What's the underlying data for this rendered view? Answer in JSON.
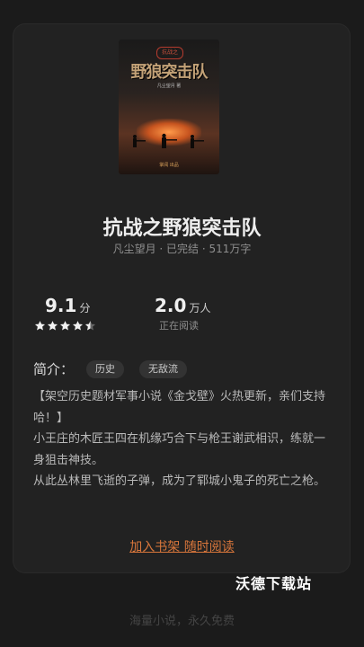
{
  "book": {
    "cover": {
      "series_tag": "抗战之",
      "title": "野狼突击队",
      "author_line": "凡尘望月 著",
      "publisher": "掌阅 出品"
    },
    "title": "抗战之野狼突击队",
    "meta": "凡尘望月 · 已完结 · 511万字"
  },
  "stats": {
    "score_value": "9.1",
    "score_unit": "分",
    "rating_stars": 4.5,
    "readers_value": "2.0",
    "readers_unit": "万人",
    "readers_label": "正在阅读"
  },
  "intro": {
    "label": "简介：",
    "tags": [
      "历史",
      "无敌流"
    ],
    "paragraphs": [
      "【架空历史题材军事小说《金戈壁》火热更新，亲们支持哈！】",
      "小王庄的木匠王四在机缘巧合下与枪王谢武相识，练就一身狙击神技。",
      "从此丛林里飞逝的子弹，成为了郓城小鬼子的死亡之枪。"
    ]
  },
  "cta_label": "加入书架 随时阅读",
  "watermark": "沃德下载站",
  "footer": "海量小说，永久免费",
  "colors": {
    "background": "#1b1b1b",
    "card": "#222222",
    "accent": "#d8763b"
  }
}
